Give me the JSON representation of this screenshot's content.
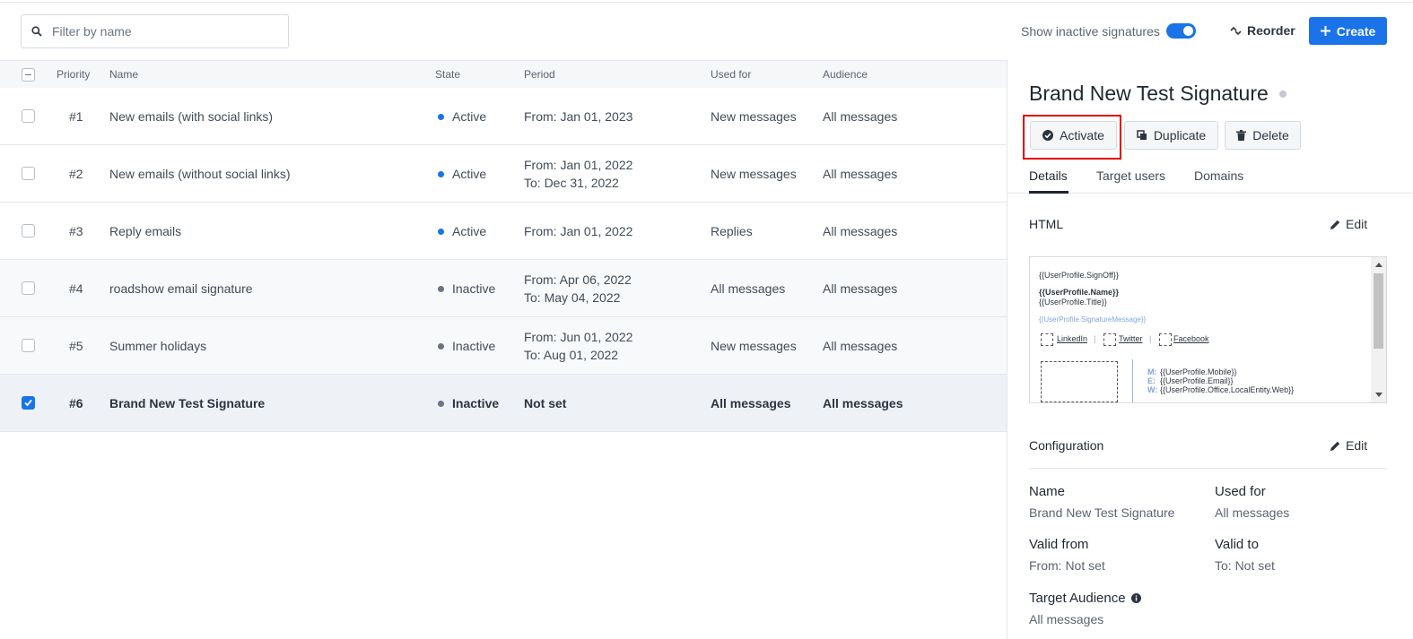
{
  "toolbar": {
    "filter_placeholder": "Filter by name",
    "show_inactive_label": "Show inactive signatures",
    "show_inactive_on": true,
    "reorder_label": "Reorder",
    "create_label": "Create"
  },
  "table": {
    "headers": {
      "priority": "Priority",
      "name": "Name",
      "state": "State",
      "period": "Period",
      "used_for": "Used for",
      "audience": "Audience"
    },
    "rows": [
      {
        "priority": "#1",
        "name": "New emails (with social links)",
        "state": "Active",
        "period": [
          "From: Jan 01, 2023"
        ],
        "used_for": "New messages",
        "audience": "All messages"
      },
      {
        "priority": "#2",
        "name": "New emails (without social links)",
        "state": "Active",
        "period": [
          "From: Jan 01, 2022",
          "To: Dec 31, 2022"
        ],
        "used_for": "New messages",
        "audience": "All messages"
      },
      {
        "priority": "#3",
        "name": "Reply emails",
        "state": "Active",
        "period": [
          "From: Jan 01, 2022"
        ],
        "used_for": "Replies",
        "audience": "All messages"
      },
      {
        "priority": "#4",
        "name": "roadshow email signature",
        "state": "Inactive",
        "period": [
          "From: Apr 06, 2022",
          "To: May 04, 2022"
        ],
        "used_for": "All messages",
        "audience": "All messages"
      },
      {
        "priority": "#5",
        "name": "Summer holidays",
        "state": "Inactive",
        "period": [
          "From: Jun 01, 2022",
          "To: Aug 01, 2022"
        ],
        "used_for": "New messages",
        "audience": "All messages"
      },
      {
        "priority": "#6",
        "name": "Brand New Test Signature",
        "state": "Inactive",
        "period": [
          "Not set"
        ],
        "used_for": "All messages",
        "audience": "All messages"
      }
    ]
  },
  "panel": {
    "title": "Brand New Test Signature",
    "buttons": {
      "activate": "Activate",
      "duplicate": "Duplicate",
      "delete": "Delete"
    },
    "tabs": [
      "Details",
      "Target users",
      "Domains"
    ],
    "html_section": {
      "title": "HTML",
      "edit_label": "Edit",
      "preview": {
        "signoff": "{{UserProfile.SignOff}}",
        "name": "{{UserProfile.Name}}",
        "title": "{{UserProfile.Title}}",
        "message": "{{UserProfile.SignatureMessage}}",
        "links": [
          "LinkedIn",
          "Twitter",
          "Facebook"
        ],
        "divider": "|",
        "contact": [
          {
            "label": "M:",
            "value": "{{UserProfile.Mobile}}"
          },
          {
            "label": "E:",
            "value": "{{UserProfile.Email}}"
          },
          {
            "label": "W:",
            "value": "{{UserProfile.Office.LocalEntity.Web}}"
          }
        ]
      }
    },
    "configuration": {
      "title": "Configuration",
      "edit_label": "Edit",
      "name_label": "Name",
      "name_value": "Brand New Test Signature",
      "used_for_label": "Used for",
      "used_for_value": "All messages",
      "valid_from_label": "Valid from",
      "valid_from_value": "From: Not set",
      "valid_to_label": "Valid to",
      "valid_to_value": "To: Not set",
      "target_audience_label": "Target Audience",
      "target_audience_value": "All messages"
    }
  },
  "colors": {
    "accent": "#1a73e8",
    "active_dot": "#1a73e8",
    "inactive_dot": "#6b7480",
    "highlight": "#e00000"
  }
}
